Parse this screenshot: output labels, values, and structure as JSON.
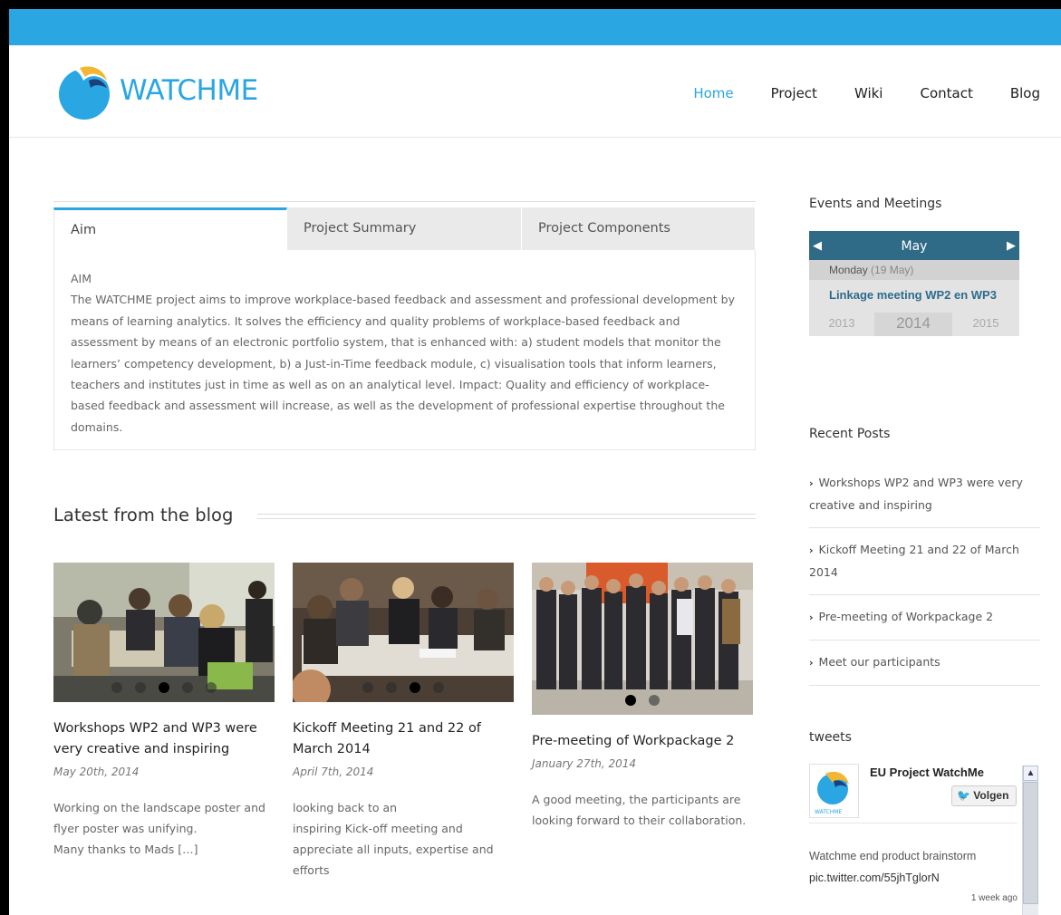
{
  "header": {
    "logo_text": "WATCHME",
    "nav": [
      "Home",
      "Project",
      "Wiki",
      "Contact",
      "Blog"
    ],
    "active_nav": "Home",
    "accent_color": "#2aa6e3"
  },
  "tabs": {
    "items": [
      "Aim",
      "Project Summary",
      "Project Components"
    ],
    "active": "Aim",
    "panel_title": "AIM",
    "panel_text": "The WATCHME project aims to improve workplace-based feedback and assessment and professional development by means of learning analytics. It solves the efficiency and quality problems of workplace-based feedback and assessment by means of an electronic portfolio system, that is enhanced with: a) student models that monitor the learners’ competency development, b) a Just-in-Time feedback module, c) visualisation tools that inform learners, teachers and institutes just in time as well as on an analytical level. Impact: Quality and efficiency of workplace-based feedback and assessment will increase, as well as the development of professional expertise throughout the domains."
  },
  "blog": {
    "heading": "Latest from the blog",
    "posts": [
      {
        "title": "Workshops WP2 and WP3 were very creative and inspiring",
        "date": "May 20th, 2014",
        "excerpt_lines": [
          "Working on the landscape poster and",
          "flyer poster was unifying.",
          "Many thanks to Mads […]"
        ]
      },
      {
        "title": "Kickoff Meeting 21 and 22 of March 2014",
        "date": "April 7th, 2014",
        "excerpt_lines": [
          "looking back to an",
          "inspiring Kick-off meeting and",
          "appreciate all inputs, expertise and",
          "efforts"
        ]
      },
      {
        "title": "Pre-meeting of Workpackage 2",
        "date": "January 27th, 2014",
        "excerpt_lines": [
          "A good meeting, the participants are",
          "looking forward to their collaboration."
        ]
      }
    ]
  },
  "sidebar": {
    "events_title": "Events and Meetings",
    "calendar": {
      "month": "May",
      "prev_icon": "◀",
      "next_icon": "▶",
      "day": "Monday",
      "day_date": "(19 May)",
      "event": "Linkage meeting WP2 en WP3",
      "years": [
        "2013",
        "2014",
        "2015"
      ]
    },
    "recent_title": "Recent Posts",
    "recent_posts": [
      "Workshops WP2 and WP3 were very creative and inspiring",
      "Kickoff Meeting 21 and 22 of March 2014",
      "Pre-meeting of Workpackage 2",
      "Meet our participants"
    ],
    "tweets_title": "tweets",
    "tweet": {
      "account": "EU Project WatchMe",
      "follow": "Volgen",
      "avatar_caption": "WATCHME",
      "text": "Watchme end product brainstorm",
      "link": "pic.twitter.com/55jhTglorN",
      "time": "1 week ago"
    }
  }
}
